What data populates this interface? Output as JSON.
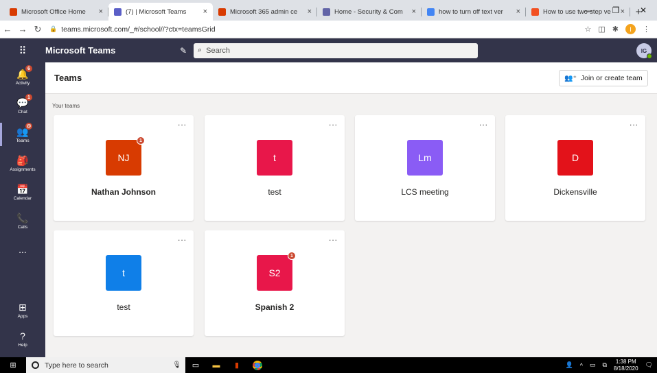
{
  "browser": {
    "tabs": [
      {
        "title": "Microsoft Office Home",
        "color": "#d83b01",
        "active": false
      },
      {
        "title": "(7) | Microsoft Teams",
        "color": "#5b5fc7",
        "active": true
      },
      {
        "title": "Microsoft 365 admin ce",
        "color": "#d83b01",
        "active": false
      },
      {
        "title": "Home - Security & Com",
        "color": "#6264a7",
        "active": false
      },
      {
        "title": "how to turn off text ver",
        "color": "#4285f4",
        "active": false
      },
      {
        "title": "How to use two-step ve",
        "color": "#f25022",
        "active": false
      }
    ],
    "tab_close": "×",
    "new_tab": "+",
    "url": "teams.microsoft.com/_#/school//?ctx=teamsGrid"
  },
  "header": {
    "app_title": "Microsoft Teams",
    "search_placeholder": "Search",
    "user_initials": "IG"
  },
  "rail": {
    "items": [
      {
        "label": "Activity",
        "icon": "bell-icon",
        "glyph": "🔔",
        "badge": "6"
      },
      {
        "label": "Chat",
        "icon": "chat-icon",
        "glyph": "💬",
        "badge": "1"
      },
      {
        "label": "Teams",
        "icon": "teams-icon",
        "glyph": "👥",
        "badge": "@"
      },
      {
        "label": "Assignments",
        "icon": "assignments-icon",
        "glyph": "🎒",
        "badge": ""
      },
      {
        "label": "Calendar",
        "icon": "calendar-icon",
        "glyph": "📅",
        "badge": ""
      },
      {
        "label": "Calls",
        "icon": "phone-icon",
        "glyph": "📞",
        "badge": ""
      }
    ],
    "more": "...",
    "apps_label": "Apps",
    "help_label": "Help"
  },
  "main": {
    "title": "Teams",
    "join_label": "Join or create team",
    "section_label": "Your teams",
    "teams": [
      {
        "name": "Nathan Johnson",
        "initials": "NJ",
        "color": "#d83b01",
        "badge": "1",
        "bold": true
      },
      {
        "name": "test",
        "initials": "t",
        "color": "#e8174a",
        "badge": "",
        "bold": false
      },
      {
        "name": "LCS meeting",
        "initials": "Lm",
        "color": "#8a5cf5",
        "badge": "",
        "bold": false
      },
      {
        "name": "Dickensville",
        "initials": "D",
        "color": "#e3121a",
        "badge": "",
        "bold": false
      },
      {
        "name": "test",
        "initials": "t",
        "color": "#0f7fe8",
        "badge": "",
        "bold": false
      },
      {
        "name": "Spanish 2",
        "initials": "S2",
        "color": "#e8174a",
        "badge": "1",
        "bold": true
      }
    ],
    "more_glyph": "..."
  },
  "taskbar": {
    "search_placeholder": "Type here to search",
    "time": "1:38 PM",
    "date": "8/18/2020"
  }
}
